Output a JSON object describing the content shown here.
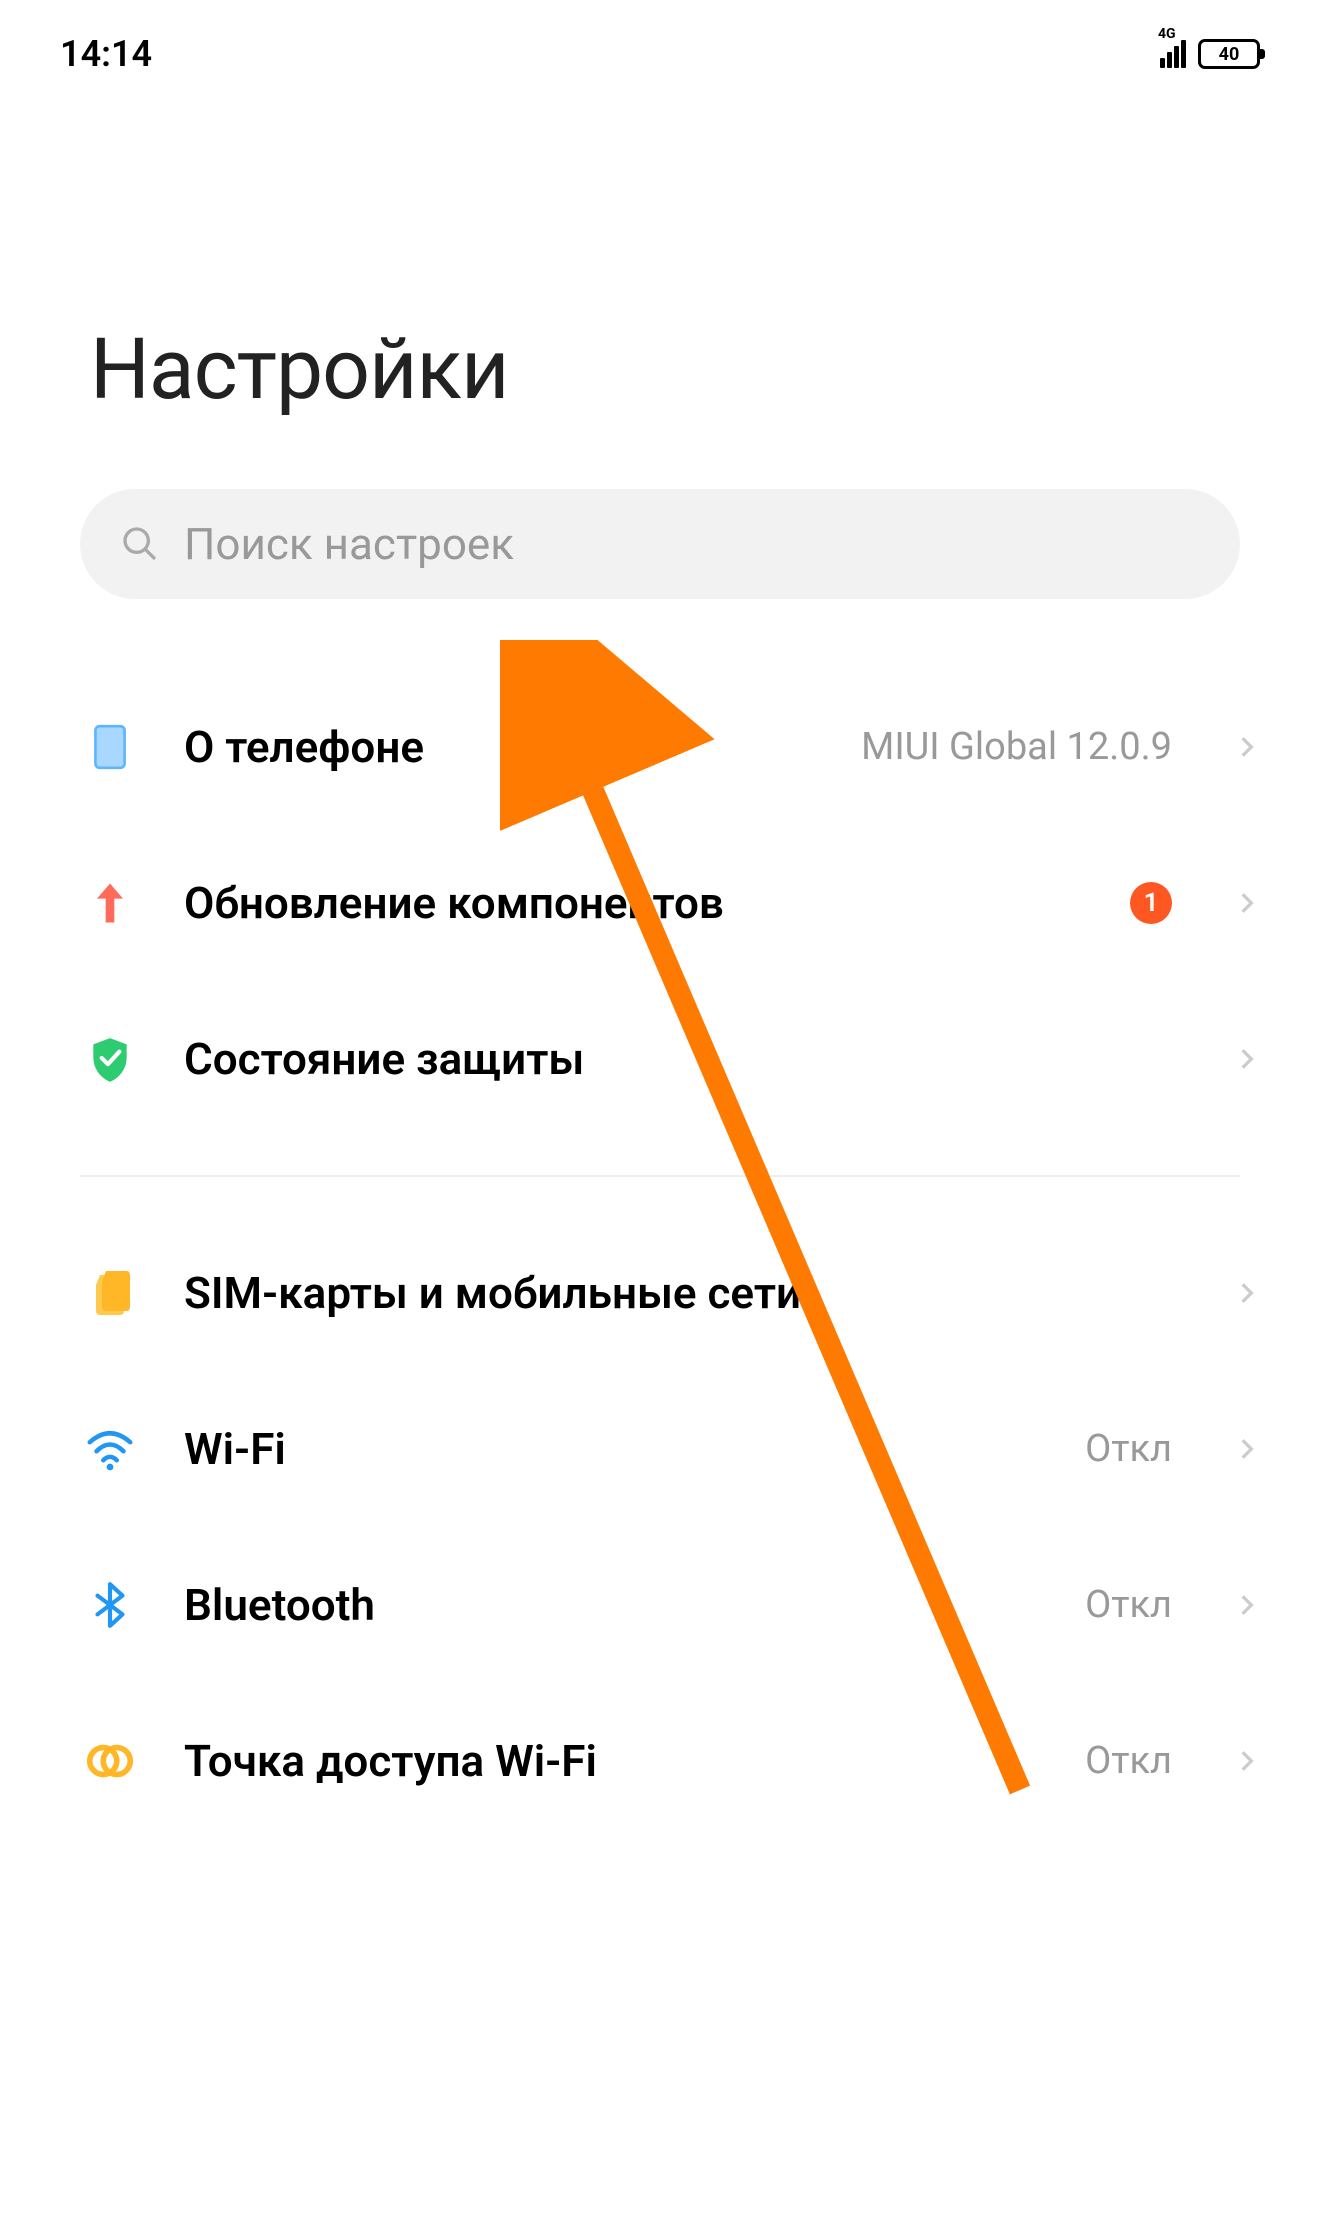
{
  "status": {
    "time": "14:14",
    "network_type": "4G",
    "battery_level": "40"
  },
  "page": {
    "title": "Настройки"
  },
  "search": {
    "placeholder": "Поиск настроек"
  },
  "groups": [
    {
      "items": [
        {
          "icon": "phone-icon",
          "label": "О телефоне",
          "value": "MIUI Global 12.0.9",
          "badge": null
        },
        {
          "icon": "update-icon",
          "label": "Обновление компонентов",
          "value": null,
          "badge": "1"
        },
        {
          "icon": "shield-icon",
          "label": "Состояние защиты",
          "value": null,
          "badge": null
        }
      ]
    },
    {
      "items": [
        {
          "icon": "sim-icon",
          "label": "SIM-карты и мобильные сети",
          "value": null,
          "badge": null
        },
        {
          "icon": "wifi-icon",
          "label": "Wi-Fi",
          "value": "Откл",
          "badge": null
        },
        {
          "icon": "bluetooth-icon",
          "label": "Bluetooth",
          "value": "Откл",
          "badge": null
        },
        {
          "icon": "hotspot-icon",
          "label": "Точка доступа Wi-Fi",
          "value": "Откл",
          "badge": null
        }
      ]
    }
  ],
  "annotation": {
    "type": "arrow",
    "color": "#ff7a00"
  }
}
